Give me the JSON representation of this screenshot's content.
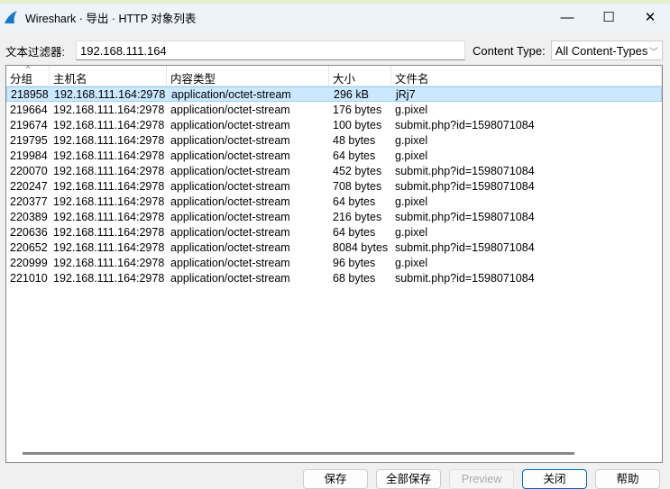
{
  "window": {
    "title": "Wireshark · 导出 · HTTP 对象列表",
    "minimize": "—",
    "maximize": "☐",
    "close": "✕"
  },
  "filter": {
    "label": "文本过滤器:",
    "value": "192.168.111.164",
    "content_type_label": "Content Type:",
    "content_type_value": "All Content-Types"
  },
  "table": {
    "headers": [
      "分组",
      "主机名",
      "内容类型",
      "大小",
      "文件名"
    ],
    "rows": [
      [
        "218958",
        "192.168.111.164:2978",
        "application/octet-stream",
        "296 kB",
        "jRj7"
      ],
      [
        "219664",
        "192.168.111.164:2978",
        "application/octet-stream",
        "176 bytes",
        "g.pixel"
      ],
      [
        "219674",
        "192.168.111.164:2978",
        "application/octet-stream",
        "100 bytes",
        "submit.php?id=1598071084"
      ],
      [
        "219795",
        "192.168.111.164:2978",
        "application/octet-stream",
        "48 bytes",
        "g.pixel"
      ],
      [
        "219984",
        "192.168.111.164:2978",
        "application/octet-stream",
        "64 bytes",
        "g.pixel"
      ],
      [
        "220070",
        "192.168.111.164:2978",
        "application/octet-stream",
        "452 bytes",
        "submit.php?id=1598071084"
      ],
      [
        "220247",
        "192.168.111.164:2978",
        "application/octet-stream",
        "708 bytes",
        "submit.php?id=1598071084"
      ],
      [
        "220377",
        "192.168.111.164:2978",
        "application/octet-stream",
        "64 bytes",
        "g.pixel"
      ],
      [
        "220389",
        "192.168.111.164:2978",
        "application/octet-stream",
        "216 bytes",
        "submit.php?id=1598071084"
      ],
      [
        "220636",
        "192.168.111.164:2978",
        "application/octet-stream",
        "64 bytes",
        "g.pixel"
      ],
      [
        "220652",
        "192.168.111.164:2978",
        "application/octet-stream",
        "8084 bytes",
        "submit.php?id=1598071084"
      ],
      [
        "220999",
        "192.168.111.164:2978",
        "application/octet-stream",
        "96 bytes",
        "g.pixel"
      ],
      [
        "221010",
        "192.168.111.164:2978",
        "application/octet-stream",
        "68 bytes",
        "submit.php?id=1598071084"
      ]
    ]
  },
  "buttons": {
    "save": "保存",
    "save_all": "全部保存",
    "preview": "Preview",
    "close": "关闭",
    "help": "帮助"
  },
  "colors": {
    "selection": "#cce8ff",
    "accent": "#0067c0"
  }
}
